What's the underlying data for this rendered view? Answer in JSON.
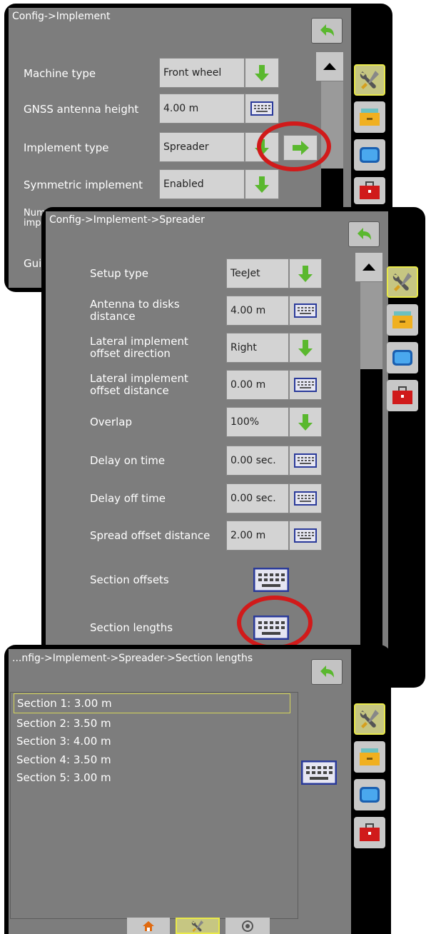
{
  "colors": {
    "accent_green": "#5ab82e",
    "highlight_ring": "#d11a1a",
    "selection_outline": "#d7d75a"
  },
  "panel1": {
    "title": "Config->Implement",
    "rows": [
      {
        "label": "Machine type",
        "value": "Front wheel",
        "control": "arrow-down-icon"
      },
      {
        "label": "GNSS antenna height",
        "value": "4.00 m",
        "control": "keyboard-icon"
      },
      {
        "label": "Implement type",
        "value": "Spreader",
        "control": "arrow-down-icon"
      },
      {
        "label": "Symmetric implement",
        "value": "Enabled",
        "control": "arrow-down-icon"
      },
      {
        "label": "Num impl",
        "value": "",
        "control": ""
      },
      {
        "label": "Guic",
        "value": "",
        "control": ""
      }
    ]
  },
  "panel2": {
    "title": "Config->Implement->Spreader",
    "rows": [
      {
        "label": "Setup type",
        "value": "TeeJet",
        "control": "arrow-down-icon"
      },
      {
        "label": "Antenna to disks distance",
        "value": "4.00 m",
        "control": "keyboard-icon"
      },
      {
        "label": "Lateral implement offset direction",
        "value": "Right",
        "control": "arrow-down-icon"
      },
      {
        "label": "Lateral implement offset distance",
        "value": "0.00 m",
        "control": "keyboard-icon"
      },
      {
        "label": "Overlap",
        "value": "100%",
        "control": "arrow-down-icon"
      },
      {
        "label": "Delay on time",
        "value": "0.00 sec.",
        "control": "keyboard-icon"
      },
      {
        "label": "Delay off time",
        "value": "0.00 sec.",
        "control": "keyboard-icon"
      },
      {
        "label": "Spread offset distance",
        "value": "2.00 m",
        "control": "keyboard-icon"
      },
      {
        "label": "Section offsets",
        "value": "",
        "control": "keyboard-icon"
      },
      {
        "label": "Section lengths",
        "value": "",
        "control": "keyboard-icon"
      }
    ]
  },
  "panel3": {
    "title": "...nfig->Implement->Spreader->Section lengths",
    "sections": [
      "Section 1: 3.00 m",
      "Section 2: 3.50 m",
      "Section 3: 4.00 m",
      "Section 4: 3.50 m",
      "Section 5: 3.00 m"
    ]
  },
  "sidebar_icons": [
    "tools-icon",
    "data-folder-icon",
    "display-icon",
    "toolbox-icon"
  ],
  "bottom_tabs": [
    "home-icon",
    "tools-icon",
    "satellite-icon"
  ]
}
